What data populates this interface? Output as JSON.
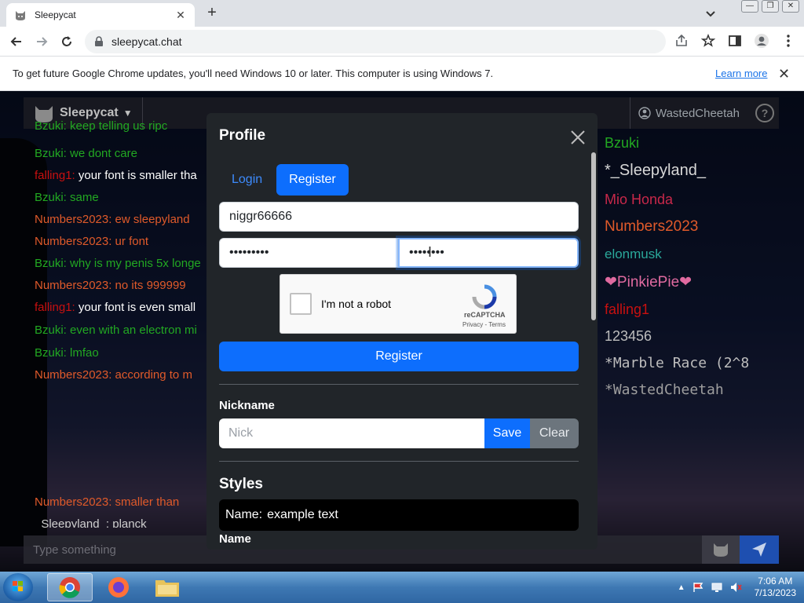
{
  "browser": {
    "tab_title": "Sleepycat",
    "url": "sleepycat.chat",
    "info_message": "To get future Google Chrome updates, you'll need Windows 10 or later. This computer is using Windows 7.",
    "info_link": "Learn more"
  },
  "app": {
    "brand": "Sleepycat",
    "username": "WastedCheetah",
    "input_placeholder": "Type something",
    "chat": [
      {
        "nick": "Bzuki:",
        "text": " keep telling us ripc",
        "nick_color": "#22a822",
        "text_color": "#22a822"
      },
      {
        "nick": "Bzuki:",
        "text": " we dont care",
        "nick_color": "#22a822",
        "text_color": "#22a822"
      },
      {
        "nick": "falling1:",
        "text": " your font is smaller tha",
        "nick_color": "#c81010",
        "text_color": "#ffffff"
      },
      {
        "nick": "Bzuki:",
        "text": " same",
        "nick_color": "#22a822",
        "text_color": "#22a822"
      },
      {
        "nick": "Numbers2023:",
        "text": " ew sleepyland",
        "nick_color": "#e05a2a",
        "text_color": "#e05a2a"
      },
      {
        "nick": "Numbers2023:",
        "text": " ur font",
        "nick_color": "#e05a2a",
        "text_color": "#e05a2a"
      },
      {
        "nick": "Bzuki:",
        "text": " why is my penis 5x longe",
        "nick_color": "#22a822",
        "text_color": "#22a822"
      },
      {
        "nick": "Numbers2023:",
        "text": " no its 999999",
        "nick_color": "#e05a2a",
        "text_color": "#e05a2a"
      },
      {
        "nick": "falling1:",
        "text": " your font is even small",
        "nick_color": "#c81010",
        "text_color": "#ffffff"
      },
      {
        "nick": "Bzuki:",
        "text": " even with an electron mi",
        "nick_color": "#22a822",
        "text_color": "#22a822"
      },
      {
        "nick": "Bzuki:",
        "text": " lmfao",
        "nick_color": "#22a822",
        "text_color": "#22a822"
      },
      {
        "nick": "Numbers2023:",
        "text": " according to m",
        "nick_color": "#e05a2a",
        "text_color": "#e05a2a"
      },
      {
        "nick": "Numbers2023:",
        "text": " smaller than",
        "nick_color": "#e05a2a",
        "text_color": "#e05a2a"
      },
      {
        "nick": "_Sleepyland_:",
        "text": " planck",
        "nick_color": "#d0d0d0",
        "text_color": "#cfcfcf"
      }
    ],
    "users": [
      {
        "name": "Bzuki",
        "color": "#22a822"
      },
      {
        "name": "*_Sleepyland_",
        "color": "#d8d8d8"
      },
      {
        "name": "Mio Honda",
        "color": "#c8284a"
      },
      {
        "name": "Numbers2023",
        "color": "#e05a2a"
      },
      {
        "name": "elonmusk",
        "color": "#2aa89a"
      },
      {
        "name": "❤PinkiePie❤",
        "color": "#e06aa0"
      },
      {
        "name": "falling1",
        "color": "#c81010"
      },
      {
        "name": "123456",
        "color": "#bdbdbd"
      },
      {
        "name": "*Marble Race (2^8",
        "color": "#bdbdbd"
      },
      {
        "name": "*WastedCheetah",
        "color": "#9e9e9e"
      }
    ]
  },
  "modal": {
    "title": "Profile",
    "tab_login": "Login",
    "tab_register": "Register",
    "username_value": "niggr66666",
    "password_value": "•••••••••",
    "confirm_value": "••••••••",
    "captcha_label": "I'm not a robot",
    "captcha_brand": "reCAPTCHA",
    "captcha_terms": "Privacy - Terms",
    "register_button": "Register",
    "nickname_label": "Nickname",
    "nick_placeholder": "Nick",
    "save_button": "Save",
    "clear_button": "Clear",
    "styles_heading": "Styles",
    "example_label": "Name:",
    "example_text": "example text",
    "name_label": "Name"
  },
  "taskbar": {
    "time": "7:06 AM",
    "date": "7/13/2023"
  }
}
